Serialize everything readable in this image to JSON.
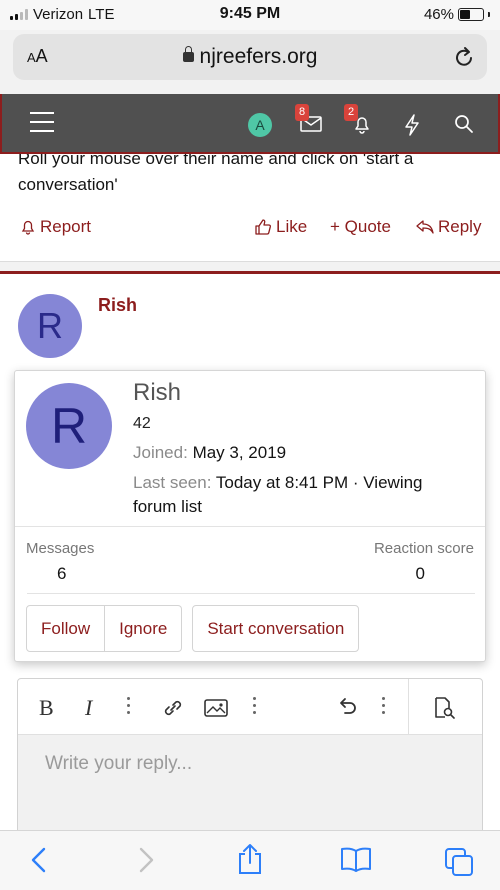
{
  "status": {
    "carrier": "Verizon",
    "network": "LTE",
    "time": "9:45 PM",
    "battery": "46%",
    "battery_level": 0.46
  },
  "browser": {
    "text_size_label_small": "A",
    "text_size_label_large": "A",
    "host": "njreefers.org"
  },
  "navbar": {
    "avatar_letter": "A",
    "inbox_count": "8",
    "alerts_count": "2"
  },
  "post1": {
    "text": "Roll your mouse over their name and click on 'start a conversation'",
    "report": "Report",
    "like": "Like",
    "quote": "+ Quote",
    "reply": "Reply"
  },
  "post2": {
    "avatar_letter": "R",
    "username": "Rish"
  },
  "profile_popup": {
    "avatar_letter": "R",
    "name": "Rish",
    "title": "42",
    "joined_label": "Joined:",
    "joined_value": "May 3, 2019",
    "seen_label": "Last seen:",
    "seen_value": "Today at 8:41 PM · Viewing forum list",
    "messages_label": "Messages",
    "messages_value": "6",
    "reaction_label": "Reaction score",
    "reaction_value": "0",
    "follow": "Follow",
    "ignore": "Ignore",
    "start_conversation": "Start conversation"
  },
  "editor": {
    "placeholder": "Write your reply..."
  },
  "colors": {
    "accent": "#8c1d1d",
    "navbar": "#505050",
    "avatar": "#8586d6",
    "badge": "#d9433b"
  }
}
